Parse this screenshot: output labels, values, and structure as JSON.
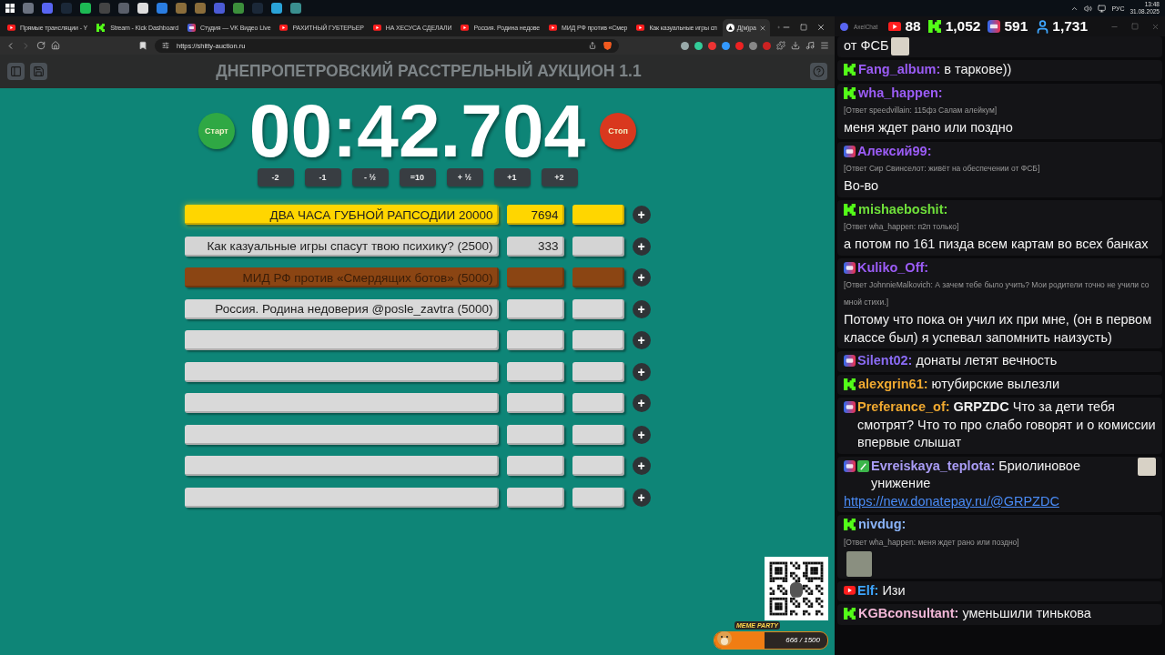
{
  "taskbar": {
    "language": "РУС",
    "time": "13:48",
    "date": "31.08.2025"
  },
  "browser": {
    "tabs": [
      {
        "kind": "youtube",
        "title": "Прямые трансляции - Y",
        "selected": false
      },
      {
        "kind": "kick",
        "title": "Stream - Kick Dashboard",
        "selected": false
      },
      {
        "kind": "vk",
        "title": "Студия — VK Видео Live",
        "selected": false
      },
      {
        "kind": "youtube",
        "title": "РАХИТНЫЙ ГУБТЕРЬЕР",
        "selected": false
      },
      {
        "kind": "youtube",
        "title": "НА ХЕСУСА СДЕЛАЛИ",
        "selected": false
      },
      {
        "kind": "youtube",
        "title": "Россия. Родина недове",
        "selected": false
      },
      {
        "kind": "youtube",
        "title": "МИД РФ против «Смер",
        "selected": false
      },
      {
        "kind": "youtube",
        "title": "Как казуальные игры сп",
        "selected": false
      },
      {
        "kind": "site",
        "title": "Д(м)ра",
        "selected": true
      }
    ],
    "url": "https://shitty-auction.ru"
  },
  "page": {
    "title": "ДНЕПРОПЕТРОВСКИЙ РАССТРЕЛЬНЫЙ АУКЦИОН 1.1",
    "timer": "00:42.704",
    "start": "Старт",
    "stop": "Стоп",
    "adjust_buttons": [
      "-2",
      "-1",
      "- ½",
      "=10",
      "+ ½",
      "+1",
      "+2"
    ],
    "add_button": "+",
    "lots": [
      {
        "name": "ДВА ЧАСА ГУБНОЙ РАПСОДИИ 20000",
        "amount": "7694",
        "color": "#ffd600"
      },
      {
        "name": "Как казуальные игры спасут твою психику? (2500)",
        "amount": "333",
        "color": "#d4d4d4"
      },
      {
        "name": "МИД РФ против «Смердящих ботов» (5000)",
        "color": "#8b4513"
      },
      {
        "name": "Россия. Родина недоверия @posle_zavtra (5000)",
        "color": "#d9d9d9"
      },
      {
        "color": "#d9d9d9"
      },
      {
        "color": "#d9d9d9"
      },
      {
        "color": "#d9d9d9"
      },
      {
        "color": "#d9d9d9"
      },
      {
        "color": "#d9d9d9"
      },
      {
        "color": "#d9d9d9"
      }
    ]
  },
  "overlay": {
    "meme_party": {
      "title": "MEME PARTY",
      "progress": "666 / 1500",
      "level": 0.444
    }
  },
  "chat": {
    "title": "AxelChat",
    "stats": [
      {
        "kind": "youtube",
        "value": "88"
      },
      {
        "kind": "kick",
        "value": "1,052"
      },
      {
        "kind": "vk",
        "value": "591"
      },
      {
        "kind": "viewers",
        "value": "1,731"
      }
    ],
    "messages": [
      {
        "text": "от ФСБ",
        "emote": true
      },
      {
        "kind": "kick",
        "author": "Fang_album:",
        "color": "#9b5cf6",
        "text": "в таркове))"
      },
      {
        "kind": "kick",
        "author": "wha_happen:",
        "color": "#9b5cf6",
        "reply": "[Ответ speedvillain: 115фз Салам алейкум]",
        "text": "меня ждет рано или поздно"
      },
      {
        "kind": "vk",
        "author": "Алексий99:",
        "color": "#9b5cf6",
        "reply": "[Ответ Сир Свинселот: живёт на обеспечении от ФСБ]",
        "text": "Во-во"
      },
      {
        "kind": "kick",
        "author": "mishaeboshit:",
        "color": "#6fe03a",
        "reply": "[Ответ wha_happen: п2п только]",
        "text": "а потом по 161 пизда всем картам во всех банках"
      },
      {
        "kind": "vk",
        "author": "Kuliko_Off:",
        "color": "#9b5cf6",
        "reply": "[Ответ JohnnieMalkovich: А зачем тебе было учить? Мои родители точно не учили со мной стихи.]",
        "text": "Потому что пока он учил их при мне, (он в первом классе был) я успевал запомнить наизусть)"
      },
      {
        "kind": "vk",
        "author": "Silent02:",
        "color": "#8b6cf6",
        "text": "донаты летят вечность"
      },
      {
        "kind": "kick",
        "author": "alexgrin61:",
        "color": "#f0a930",
        "text": "ютубирские вылезли"
      },
      {
        "kind": "vk",
        "author": "Preferance_of:",
        "color": "#f0a930",
        "text": "**GRPZDC** Что за дети тебя смотрят? Что то про слабо говорят и о комиссии впервые слышат"
      },
      {
        "kind": "vk",
        "extra_badge": true,
        "author": "Evreiskaya_teplota:",
        "color": "#a99cf5",
        "text": "Бриолиновое унижение",
        "emote": true,
        "link": "https://new.donatepay.ru/@GRPZDC"
      },
      {
        "kind": "kick",
        "author": "nivdug:",
        "color": "#8ab4f8",
        "reply": "[Ответ wha_happen: меня ждет рано или поздно]",
        "emote": true
      },
      {
        "kind": "youtube",
        "author": "Elf:",
        "color": "#3ea6ff",
        "text": "Изи"
      },
      {
        "kind": "kick",
        "author": "KGBconsultant:",
        "color": "#f3b8d8",
        "text": "уменьшили тинькова"
      }
    ]
  }
}
